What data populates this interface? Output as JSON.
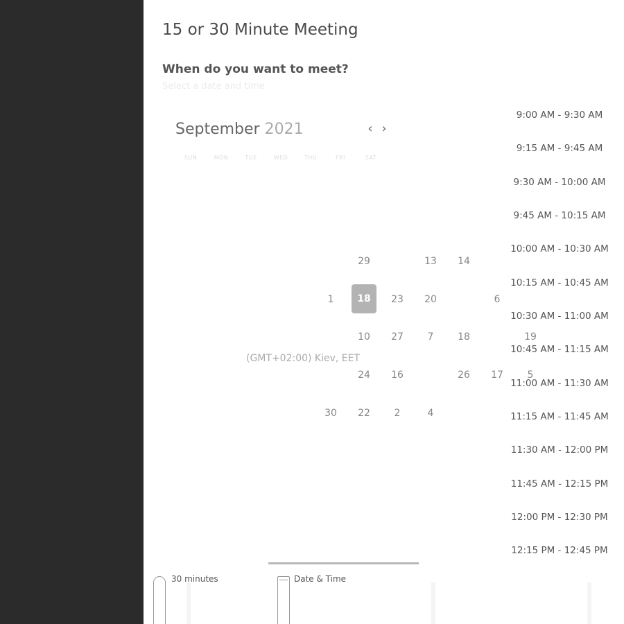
{
  "meeting": {
    "title": "15 or 30 Minute Meeting",
    "question": "When do you want to meet?",
    "subquestion": "Select a date and time"
  },
  "calendar": {
    "month": "September",
    "year": "2021",
    "prev_icon": "chevron-left-icon",
    "next_icon": "chevron-right-icon",
    "days_of_week": [
      "SUN",
      "MON",
      "TUE",
      "WED",
      "THU",
      "FRI",
      "SAT"
    ],
    "cells": [
      {
        "label": "29"
      },
      {
        "label": "13"
      },
      {
        "label": "14"
      },
      {
        "label": "1"
      },
      {
        "label": "18",
        "selected": true
      },
      {
        "label": "23"
      },
      {
        "label": "20"
      },
      {
        "label": "6"
      },
      {
        "label": "10"
      },
      {
        "label": "27"
      },
      {
        "label": "7"
      },
      {
        "label": "18"
      },
      {
        "label": "19"
      },
      {
        "label": "24"
      },
      {
        "label": "16"
      },
      {
        "label": "26"
      },
      {
        "label": "17"
      },
      {
        "label": "5"
      },
      {
        "label": "30"
      },
      {
        "label": "22"
      },
      {
        "label": "2"
      },
      {
        "label": "4"
      }
    ],
    "selected_color": "#b3b3b3"
  },
  "timezone": {
    "label": "(GMT+02:00) Kiev, EET"
  },
  "time_slots": [
    "9:00 AM - 9:30 AM",
    "9:15 AM - 9:45 AM",
    "9:30 AM - 10:00 AM",
    "9:45 AM - 10:15 AM",
    "10:00 AM - 10:30 AM",
    "10:15 AM - 10:45 AM",
    "10:30 AM - 11:00 AM",
    "10:45 AM - 11:15 AM",
    "11:00 AM - 11:30 AM",
    "11:15 AM - 11:45 AM",
    "11:30 AM - 12:00 PM",
    "11:45 AM - 12:15 PM",
    "12:00 PM - 12:30 PM",
    "12:15 PM - 12:45 PM"
  ],
  "steps": {
    "duration_label": "30 minutes",
    "datetime_label": "Date & Time",
    "duration_icon": "clock-icon",
    "datetime_icon": "calendar-icon"
  },
  "colors": {
    "sidebar": "#2b2b2b",
    "background": "#ffffff"
  }
}
